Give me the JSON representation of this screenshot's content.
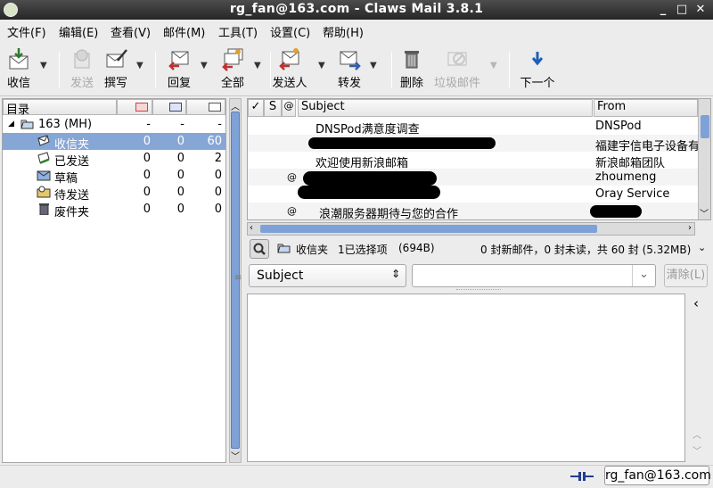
{
  "window": {
    "title": "rg_fan@163.com - Claws Mail 3.8.1"
  },
  "menubar": {
    "items": [
      "文件(F)",
      "编辑(E)",
      "查看(V)",
      "邮件(M)",
      "工具(T)",
      "设置(C)",
      "帮助(H)"
    ]
  },
  "toolbar": {
    "receive": "收信",
    "send": "发送",
    "compose": "撰写",
    "reply": "回复",
    "reply_all": "全部",
    "reply_sender": "发送人",
    "forward": "转发",
    "delete": "删除",
    "junk": "垃圾邮件",
    "next": "下一个"
  },
  "folders": {
    "header": "目录",
    "mailbox": {
      "name": "163 (MH)",
      "new": "-",
      "unread": "-",
      "total": "-"
    },
    "items": [
      {
        "name": "收信夹",
        "new": "0",
        "unread": "0",
        "total": "60"
      },
      {
        "name": "已发送",
        "new": "0",
        "unread": "0",
        "total": "2"
      },
      {
        "name": "草稿",
        "new": "0",
        "unread": "0",
        "total": "0"
      },
      {
        "name": "待发送",
        "new": "0",
        "unread": "0",
        "total": "0"
      },
      {
        "name": "废件夹",
        "new": "0",
        "unread": "0",
        "total": "0"
      }
    ]
  },
  "messages": {
    "columns": {
      "mark": "✓",
      "status": "S",
      "attach": "@",
      "subject": "Subject",
      "from": "From"
    },
    "rows": [
      {
        "subject": "DNSPod满意度调查",
        "from": "DNSPod",
        "attach": ""
      },
      {
        "subject": "",
        "from": "福建宇信电子设备有",
        "attach": ""
      },
      {
        "subject": "欢迎使用新浪邮箱",
        "from": "新浪邮箱团队",
        "attach": ""
      },
      {
        "subject": "",
        "from": "zhoumeng",
        "attach": "@"
      },
      {
        "subject": "",
        "from": "Oray Service",
        "attach": ""
      },
      {
        "subject": "浪潮服务器期待与您的合作",
        "from": "",
        "attach": "@"
      }
    ]
  },
  "infobar": {
    "folder": "收信夹",
    "selected": "1已选择项",
    "size": "(694B)",
    "summary": "0 封新邮件，0 封未读，共 60 封 (5.32MB)"
  },
  "search": {
    "field": "Subject",
    "value": "",
    "clear": "清除(L)"
  },
  "statusbar": {
    "account": "rg_fan@163.com"
  },
  "colors": {
    "selection": "#86a6d6",
    "titlebar": "#333333"
  }
}
